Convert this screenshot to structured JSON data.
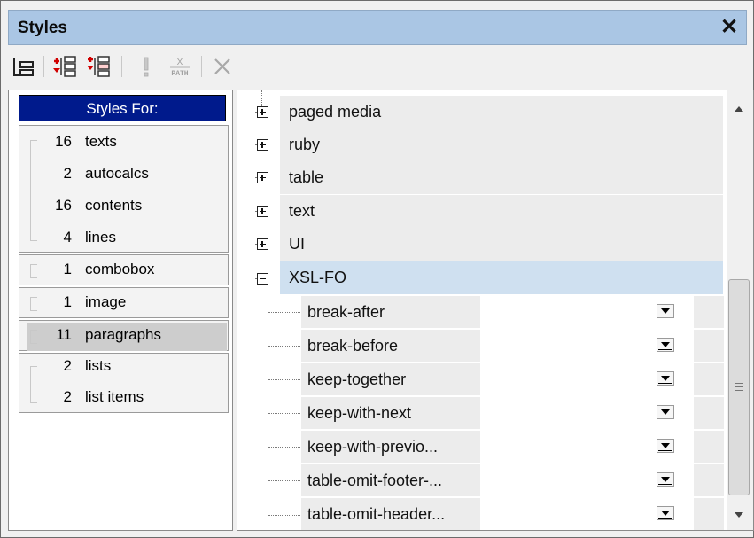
{
  "window": {
    "title": "Styles",
    "close_glyph": "✕"
  },
  "toolbar": {
    "buttons": [
      {
        "name": "tree-layout-icon"
      },
      {
        "name": "insert-before-icon"
      },
      {
        "name": "insert-after-icon"
      },
      {
        "name": "exclamation-icon"
      },
      {
        "name": "xpath-icon",
        "label_top": "X",
        "label_bottom": "PATH"
      },
      {
        "name": "delete-icon"
      }
    ]
  },
  "left_panel": {
    "header": "Styles For:",
    "groups": [
      {
        "rows": [
          {
            "count": "16",
            "label": "texts"
          },
          {
            "count": "2",
            "label": "autocalcs"
          },
          {
            "count": "16",
            "label": "contents"
          },
          {
            "count": "4",
            "label": "lines"
          }
        ]
      },
      {
        "rows": [
          {
            "count": "1",
            "label": "combobox"
          }
        ]
      },
      {
        "rows": [
          {
            "count": "1",
            "label": "image"
          }
        ]
      },
      {
        "rows": [
          {
            "count": "11",
            "label": "paragraphs"
          }
        ]
      },
      {
        "rows": [
          {
            "count": "2",
            "label": "lists"
          },
          {
            "count": "2",
            "label": "list items"
          }
        ]
      }
    ]
  },
  "right_panel": {
    "groups": [
      "paged media",
      "ruby",
      "table",
      "text",
      "UI",
      "XSL-FO"
    ],
    "expanded_group": "XSL-FO",
    "properties": [
      {
        "name": "break-after",
        "value": ""
      },
      {
        "name": "break-before",
        "value": ""
      },
      {
        "name": "keep-together",
        "value": ""
      },
      {
        "name": "keep-with-next",
        "value": ""
      },
      {
        "name": "keep-with-previo...",
        "value": ""
      },
      {
        "name": "table-omit-footer-...",
        "value": ""
      },
      {
        "name": "table-omit-header...",
        "value": ""
      }
    ]
  },
  "colors": {
    "titlebar": "#aac6e4",
    "header_bg": "#001a8c",
    "expanded_group_bg": "#cfe0f0"
  }
}
